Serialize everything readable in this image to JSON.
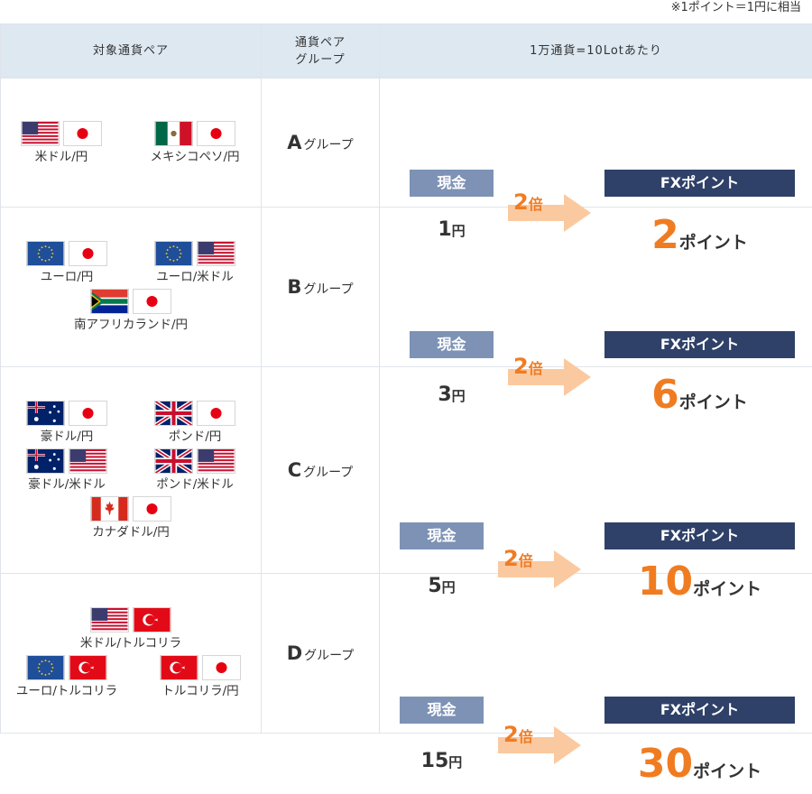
{
  "note": "※1ポイント＝1円に相当",
  "headers": {
    "pairs": "対象通貨ペア",
    "group_line1": "通貨ペア",
    "group_line2": "グループ",
    "conversion": "1万通貨=10Lotあたり"
  },
  "labels": {
    "cash": "現金",
    "fx_points": "FXポイント",
    "yen": "円",
    "point_unit": "ポイント",
    "group_suffix": "グループ",
    "multiplier_unit": "倍"
  },
  "groups": [
    {
      "letter": "A",
      "pairs": [
        {
          "label": "米ドル/円",
          "flags": [
            "us-flag",
            "jp-flag"
          ]
        },
        {
          "label": "メキシコペソ/円",
          "flags": [
            "mx-flag",
            "jp-flag"
          ]
        }
      ],
      "cash": "1",
      "multiplier": "2",
      "points": "2"
    },
    {
      "letter": "B",
      "pairs": [
        {
          "label": "ユーロ/円",
          "flags": [
            "eu-flag",
            "jp-flag"
          ]
        },
        {
          "label": "ユーロ/米ドル",
          "flags": [
            "eu-flag",
            "us-flag"
          ]
        },
        {
          "label": "南アフリカランド/円",
          "flags": [
            "za-flag",
            "jp-flag"
          ]
        }
      ],
      "cash": "3",
      "multiplier": "2",
      "points": "6"
    },
    {
      "letter": "C",
      "pairs": [
        {
          "label": "豪ドル/円",
          "flags": [
            "au-flag",
            "jp-flag"
          ]
        },
        {
          "label": "ポンド/円",
          "flags": [
            "gb-flag",
            "jp-flag"
          ]
        },
        {
          "label": "豪ドル/米ドル",
          "flags": [
            "au-flag",
            "us-flag"
          ]
        },
        {
          "label": "ポンド/米ドル",
          "flags": [
            "gb-flag",
            "us-flag"
          ]
        },
        {
          "label": "カナダドル/円",
          "flags": [
            "ca-flag",
            "jp-flag"
          ]
        }
      ],
      "cash": "5",
      "multiplier": "2",
      "points": "10"
    },
    {
      "letter": "D",
      "pairs": [
        {
          "label": "米ドル/トルコリラ",
          "flags": [
            "us-flag",
            "tr-flag"
          ]
        },
        {
          "label": "ユーロ/トルコリラ",
          "flags": [
            "eu-flag",
            "tr-flag"
          ]
        },
        {
          "label": "トルコリラ/円",
          "flags": [
            "tr-flag",
            "jp-flag"
          ]
        }
      ],
      "cash": "15",
      "multiplier": "2",
      "points": "30"
    }
  ],
  "colors": {
    "header_bg": "#dde8f1",
    "cash_box": "#7d92b5",
    "fx_box": "#2f4168",
    "accent_orange": "#f07c22",
    "arrow_fill": "#fbc9a0",
    "border": "#dfe4ea"
  }
}
